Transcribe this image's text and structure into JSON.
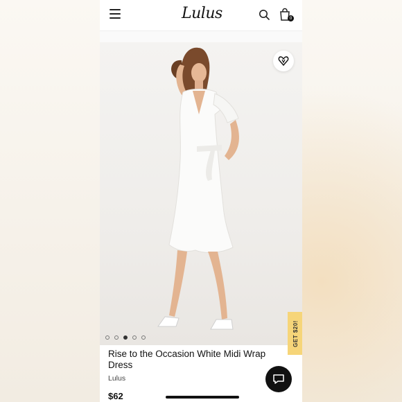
{
  "header": {
    "logo_text": "Lulus",
    "cart_count": "0",
    "icons": [
      "menu-icon",
      "search-icon",
      "shopping-bag-icon"
    ]
  },
  "gallery": {
    "image_description_icon": "product-photo",
    "dot_count": 5,
    "active_index": 2,
    "favorite_icon": "heart-icon"
  },
  "promo": {
    "tab_label": "GET $20!"
  },
  "product": {
    "title": "Rise to the Occasion White Midi Wrap Dress",
    "brand": "Lulus",
    "price": "$62"
  },
  "chat": {
    "icon": "chat-bubble-icon"
  },
  "colors": {
    "promo_tab": "#f6d579",
    "accent_dark": "#111111"
  }
}
